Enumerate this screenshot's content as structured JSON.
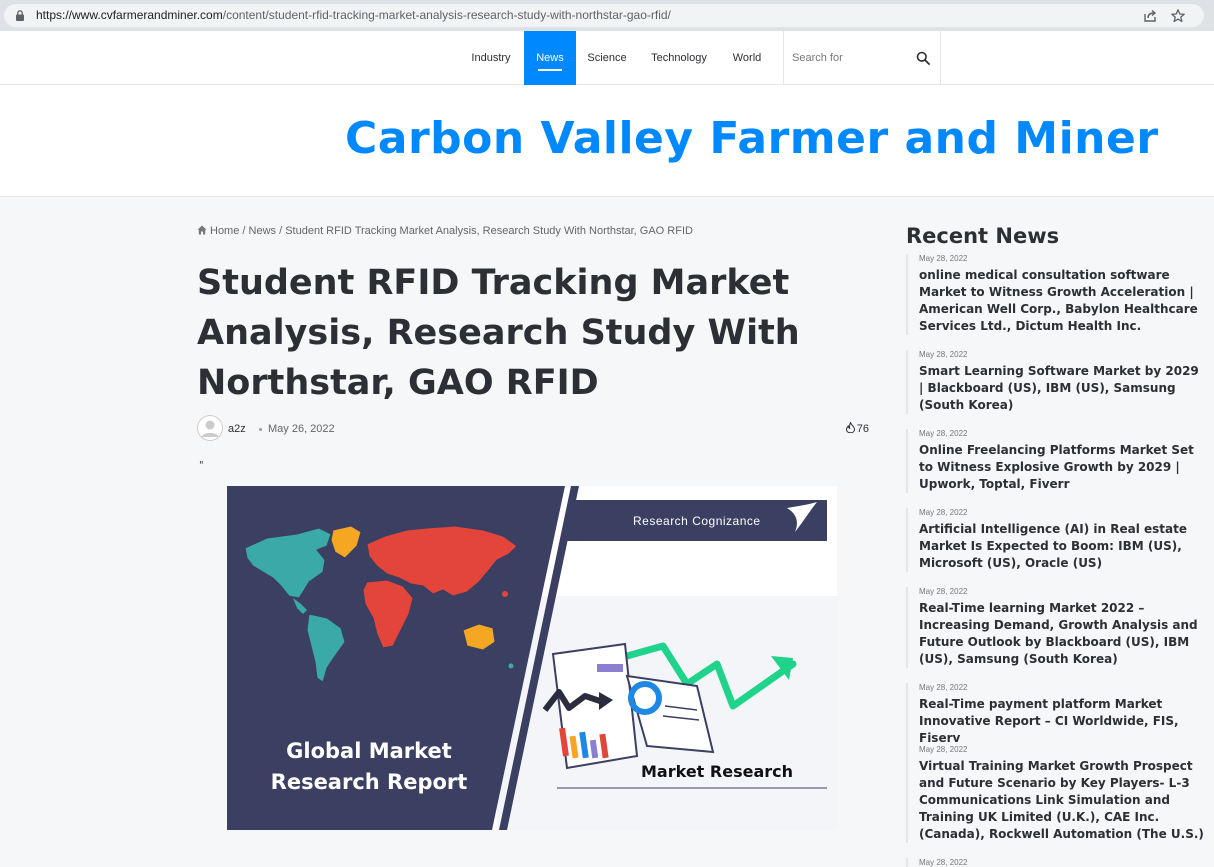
{
  "browser": {
    "url_host": "https://www.cvfarmerandminer.com",
    "url_path": "/content/student-rfid-tracking-market-analysis-research-study-with-northstar-gao-rfid/"
  },
  "nav": {
    "items": [
      {
        "label": "Industry",
        "active": false
      },
      {
        "label": "News",
        "active": true
      },
      {
        "label": "Science",
        "active": false
      },
      {
        "label": "Technology",
        "active": false
      },
      {
        "label": "World",
        "active": false
      }
    ],
    "search_placeholder": "Search for"
  },
  "header": {
    "site_title": "Carbon Valley Farmer and Miner"
  },
  "breadcrumb": {
    "home": "Home",
    "section": "News",
    "current": "Student RFID Tracking Market Analysis, Research Study With Northstar, GAO RFID"
  },
  "article": {
    "title": "Student RFID Tracking Market Analysis, Research Study With Northstar, GAO RFID",
    "author": "a2z",
    "date": "May 26, 2022",
    "views": "76",
    "quote": "\""
  },
  "hero_image": {
    "brand": "Research Cognizance",
    "left_text": "Global Market Research Report",
    "right_text": "Market Research",
    "colors": {
      "navy": "#3b3f62",
      "teal": "#3aa9a8",
      "red": "#e3453a",
      "orange": "#f5a623",
      "green": "#1fd38a"
    }
  },
  "sidebar": {
    "title": "Recent News",
    "items": [
      {
        "date": "May 28, 2022",
        "title": "online medical consultation software Market to Witness Growth Acceleration | American Well Corp., Babylon Healthcare Services Ltd., Dictum Health Inc."
      },
      {
        "date": "May 28, 2022",
        "title": "Smart Learning Software Market by 2029 | Blackboard (US), IBM (US), Samsung (South Korea)"
      },
      {
        "date": "May 28, 2022",
        "title": "Online Freelancing Platforms Market Set to Witness Explosive Growth by 2029 | Upwork, Toptal, Fiverr"
      },
      {
        "date": "May 28, 2022",
        "title": "Artificial Intelligence (AI) in Real estate Market Is Expected to Boom: IBM (US), Microsoft (US), Oracle (US)"
      },
      {
        "date": "May 28, 2022",
        "title": "Real-Time learning Market 2022 – Increasing Demand, Growth Analysis and Future Outlook by Blackboard (US), IBM (US), Samsung (South Korea)"
      },
      {
        "date": "May 28, 2022",
        "title": "Real-Time payment platform Market Innovative Report – CI Worldwide, FIS,  Fiserv"
      },
      {
        "date": "May 28, 2022",
        "title": "Virtual Training Market Growth Prospect and Future Scenario by Key Players-  L-3 Communications Link Simulation and Training UK Limited (U.K.), CAE Inc. (Canada), Rockwell Automation (The U.S.)"
      },
      {
        "date": "May 28, 2022",
        "title": ""
      }
    ]
  }
}
